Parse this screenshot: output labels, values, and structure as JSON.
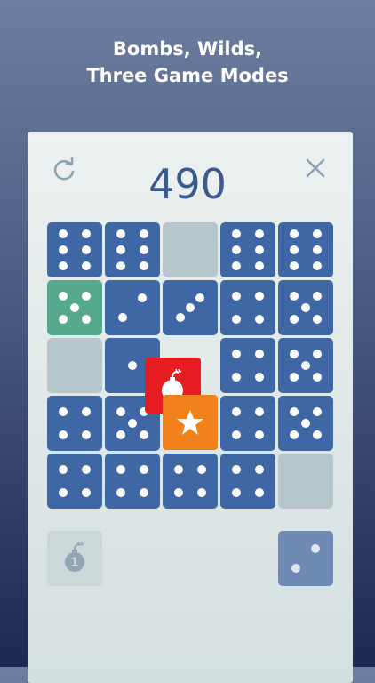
{
  "headline": {
    "line1": "Bombs, Wilds,",
    "line2": "Three Game Modes"
  },
  "game": {
    "score": "490",
    "bomb_count": "1",
    "grid": [
      [
        6,
        6,
        0,
        6,
        6
      ],
      [
        "g5",
        2,
        3,
        4,
        5
      ],
      [
        0,
        1,
        "x",
        4,
        5
      ],
      [
        4,
        5,
        "x",
        4,
        5
      ],
      [
        4,
        4,
        4,
        4,
        0
      ]
    ],
    "tray_die": 2
  },
  "colors": {
    "die": "#3f67a3",
    "wild_die": "#55a98e",
    "empty": "#b7c6ca",
    "bomb": "#e51d23",
    "star": "#f1811b"
  },
  "icons": {
    "restart": "restart-icon",
    "close": "close-icon",
    "bomb": "bomb-icon",
    "star": "star-icon"
  }
}
